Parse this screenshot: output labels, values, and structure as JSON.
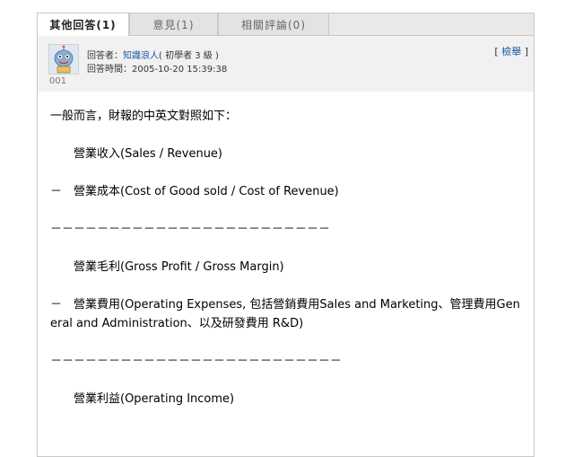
{
  "tabs": [
    {
      "label": "其他回答(1)"
    },
    {
      "label": "意見(1)"
    },
    {
      "label": "相關評論(0)"
    }
  ],
  "answer": {
    "answerer_label": "回答者：",
    "answerer_name": "知識浪人",
    "answerer_level": "( 初學者 3 級 )",
    "time_label": "回答時間：",
    "time_value": "2005-10-20 15:39:38",
    "avatar_id": "001",
    "report_open": "[ ",
    "report_label": "檢舉",
    "report_close": " ]"
  },
  "content": {
    "lines": [
      "一般而言，財報的中英文對照如下：",
      "　　營業收入(Sales / Revenue)",
      "－　營業成本(Cost of Good sold / Cost of Revenue)",
      "－－－－－－－－－－－－－－－－－－－－－－－－",
      "　　營業毛利(Gross Profit / Gross Margin)",
      "－　營業費用(Operating Expenses, 包括營銷費用Sales and Marketing、管理費用Gen",
      "eral and Administration、以及研發費用 R&D)",
      "－－－－－－－－－－－－－－－－－－－－－－－－－",
      "　　營業利益(Operating Income)"
    ]
  }
}
